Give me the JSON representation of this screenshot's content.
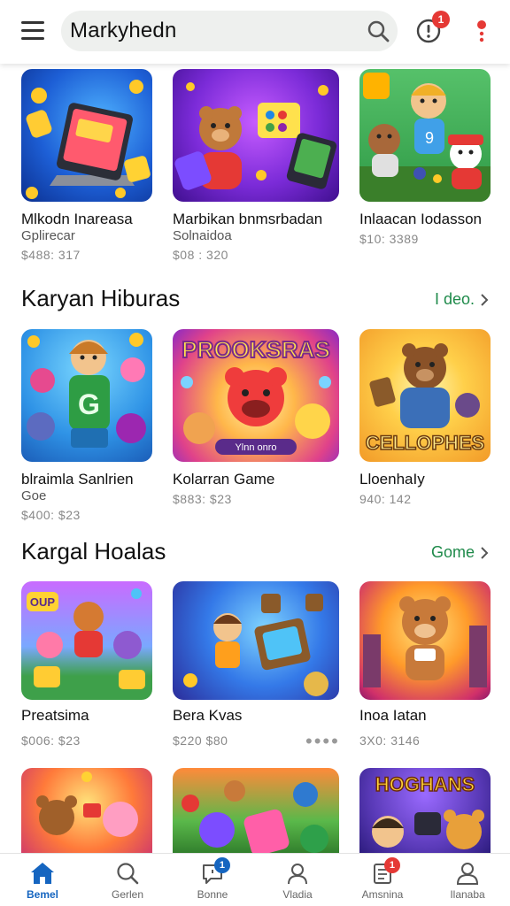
{
  "header": {
    "search_query": "Markyhedn",
    "alerts_badge": "1"
  },
  "featured": {
    "items": [
      {
        "title": "Mlkodn Inareasa",
        "subtitle": "Gplirecar",
        "price": "$488: 317"
      },
      {
        "title": "Marbikan bnmsrbadan",
        "subtitle": "Solnaidoa",
        "price": "$08 : 320"
      },
      {
        "title": "Inlaacan Iodasson",
        "subtitle": "",
        "price": "$10: 3389"
      }
    ]
  },
  "section1": {
    "title": "Karyan Hiburas",
    "more_label": "I deo.",
    "items": [
      {
        "title": "blraimla Sanlrien",
        "subtitle": "Goe",
        "price": "$400: $23",
        "art_text": "G"
      },
      {
        "title": "Kolarran Game",
        "subtitle": "",
        "price": "$883: $23",
        "art_text": "PROOKSRAS",
        "art_sub": "Ylnn onro"
      },
      {
        "title": "LloenhaIy",
        "subtitle": "",
        "price": "940: 142",
        "art_text": "CELLOPHES"
      }
    ]
  },
  "section2": {
    "title": "Kargal Hoalas",
    "more_label": "Gome",
    "items": [
      {
        "title": "Preatsima",
        "price": "$006: $23",
        "art_text": "OUP"
      },
      {
        "title": "Bera Kvas",
        "price": "$220 $80",
        "dots": "••••"
      },
      {
        "title": "Inoa Iatan",
        "price": "3X0: 3146"
      }
    ]
  },
  "section3": {
    "items": [
      {
        "art_text": ""
      },
      {
        "art_text": ""
      },
      {
        "art_text": "HOGHANS"
      }
    ]
  },
  "bottom_nav": {
    "items": [
      {
        "label": "Bemel",
        "icon": "home-icon",
        "active": true
      },
      {
        "label": "Gerlen",
        "icon": "search-icon"
      },
      {
        "label": "Bonne",
        "icon": "message-icon",
        "badge": "1",
        "badge_color": "#1565c0"
      },
      {
        "label": "Vladia",
        "icon": "person-search-icon"
      },
      {
        "label": "Amsnina",
        "icon": "document-icon",
        "badge": "1",
        "badge_color": "#e53935"
      },
      {
        "label": "Ilanaba",
        "icon": "profile-icon"
      }
    ]
  }
}
